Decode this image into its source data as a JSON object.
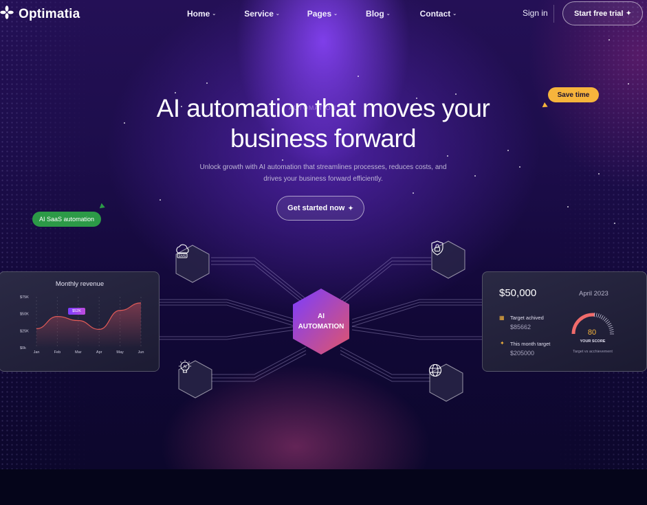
{
  "brand": {
    "name": "Optimatia"
  },
  "nav": {
    "items": [
      {
        "label": "Home"
      },
      {
        "label": "Service"
      },
      {
        "label": "Pages"
      },
      {
        "label": "Blog"
      },
      {
        "label": "Contact"
      }
    ],
    "signin": "Sign in",
    "trial": "Start free trial"
  },
  "hero": {
    "faint_label": "AUTOMATION",
    "headline_line1": "AI automation that moves your",
    "headline_line2": "business forward",
    "subtext_line1": "Unlock growth with AI automation that streamlines processes, reduces costs, and",
    "subtext_line2": "drives your business forward efficiently.",
    "cta": "Get started now"
  },
  "badges": {
    "save_time": "Save time",
    "ai_saas": "AI SaaS automation"
  },
  "network": {
    "core_line1": "AI",
    "core_line2": "AUTOMATION",
    "nodes": [
      {
        "icon": "cloud-saas-icon",
        "text": "SAAS"
      },
      {
        "icon": "shield-lock-icon"
      },
      {
        "icon": "ai-bulb-icon",
        "text": "AI"
      },
      {
        "icon": "globe-icon"
      }
    ]
  },
  "revenue_card": {
    "title": "Monthly revenue",
    "tooltip": "$52K"
  },
  "chart_data": {
    "type": "area",
    "title": "Monthly revenue",
    "categories": [
      "Jan",
      "Feb",
      "Mar",
      "Apr",
      "May",
      "Jun"
    ],
    "y_ticks": [
      "$75K",
      "$50K",
      "$25K",
      "$0k"
    ],
    "ylim": [
      0,
      75
    ],
    "series": [
      {
        "values": [
          28,
          46,
          40,
          27,
          55,
          66
        ]
      }
    ],
    "colors": {
      "line": "#e25b58",
      "fill_top": "#b84a5a"
    }
  },
  "stats_card": {
    "amount": "$50,000",
    "date": "April 2023",
    "rows": [
      {
        "label": "Target achived",
        "value": "$85662"
      },
      {
        "label": "This month target",
        "value": "$205000"
      }
    ],
    "score": "80",
    "score_fraction": 0.53,
    "score_caption": "YOUR SCORE",
    "score_sub": "Target vs acchievement"
  },
  "colors": {
    "accent_purple": "#7b3dff",
    "accent_pink": "#e0556a",
    "badge_yellow": "#f6b43c",
    "badge_green": "#2c9a47"
  }
}
